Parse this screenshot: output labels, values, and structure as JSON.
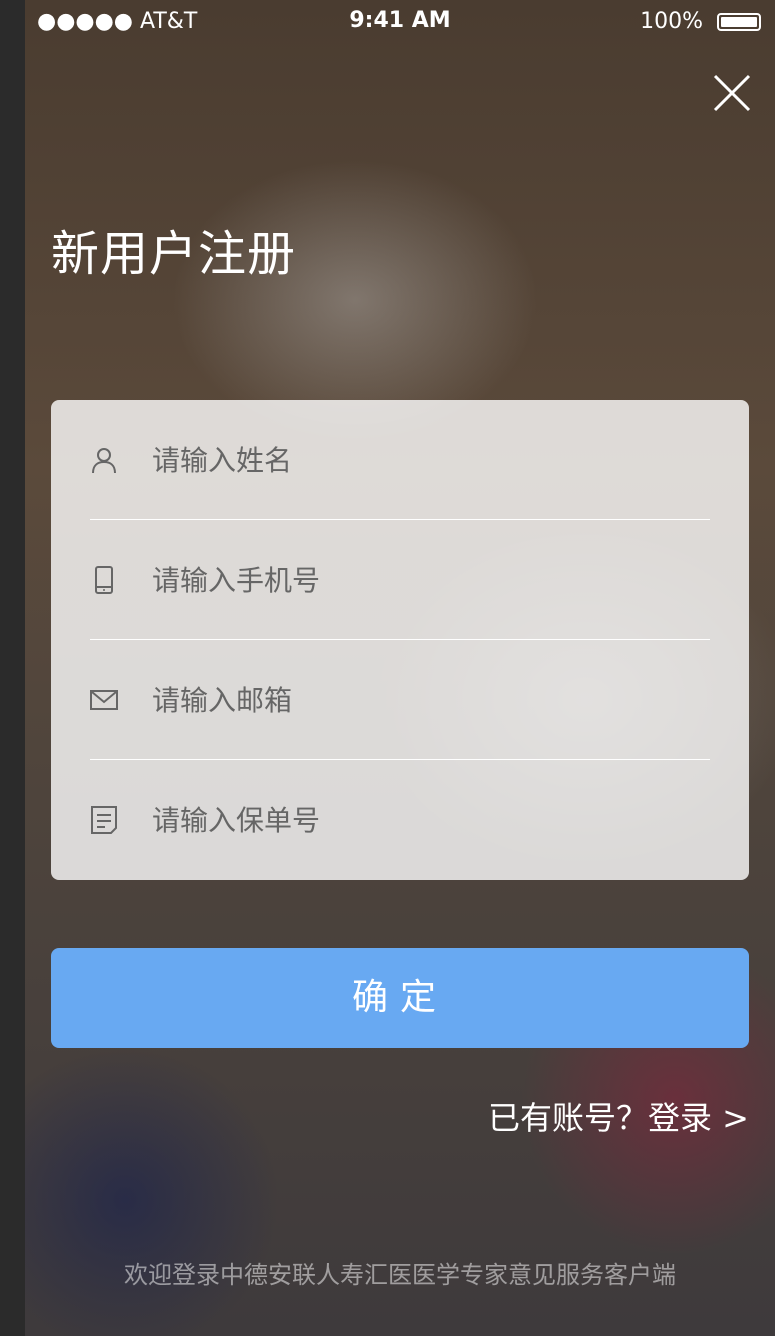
{
  "status_bar": {
    "carrier": "●●●●● AT&T",
    "time": "9:41 AM",
    "battery": "100%"
  },
  "title": "新用户注册",
  "form": {
    "name_placeholder": "请输入姓名",
    "phone_placeholder": "请输入手机号",
    "email_placeholder": "请输入邮箱",
    "policy_placeholder": "请输入保单号"
  },
  "confirm_label": "确定",
  "login_link": "已有账号？登录 >",
  "footer": "欢迎登录中德安联人寿汇医医学专家意见服务客户端",
  "colors": {
    "button": "#68a9f2",
    "placeholder": "#666666",
    "card_bg": "rgba(255,255,255,0.8)",
    "divider": "#ffffff"
  }
}
